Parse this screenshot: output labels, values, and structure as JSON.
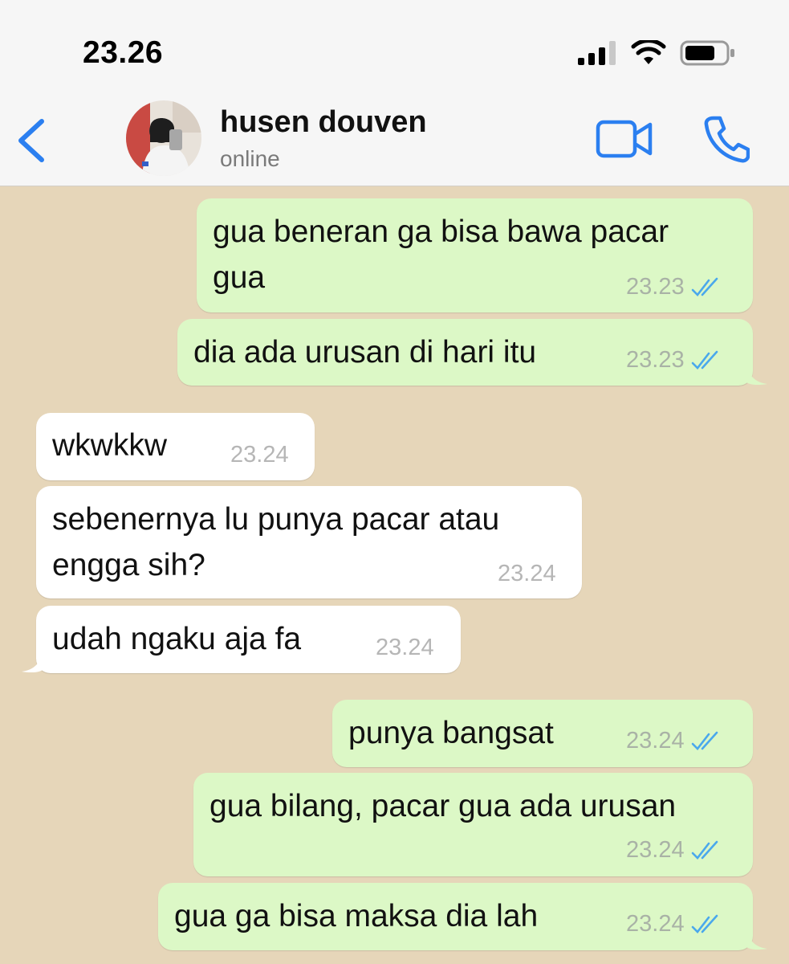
{
  "status_bar": {
    "time": "23.26",
    "signal_icon": "cellular-signal-icon",
    "wifi_icon": "wifi-icon",
    "battery_icon": "battery-icon"
  },
  "header": {
    "back_icon": "chevron-left-icon",
    "contact_name": "husen douven",
    "contact_status": "online",
    "video_icon": "video-camera-icon",
    "call_icon": "phone-icon"
  },
  "colors": {
    "accent": "#2b7ff0",
    "outgoing_bubble": "#dcf8c6",
    "incoming_bubble": "#ffffff",
    "chat_background": "#e6d6b9",
    "read_ticks": "#4aa8ec"
  },
  "messages": [
    {
      "direction": "out",
      "lines": [
        "gua beneran ga bisa bawa pacar",
        "gua"
      ],
      "time": "23.23",
      "read": true
    },
    {
      "direction": "out",
      "lines": [
        "dia ada urusan di hari itu"
      ],
      "time": "23.23",
      "read": true
    },
    {
      "direction": "in",
      "lines": [
        "wkwkkw"
      ],
      "time": "23.24"
    },
    {
      "direction": "in",
      "lines": [
        "sebenernya lu punya pacar atau",
        "engga sih?"
      ],
      "time": "23.24"
    },
    {
      "direction": "in",
      "lines": [
        "udah ngaku aja fa"
      ],
      "time": "23.24"
    },
    {
      "direction": "out",
      "lines": [
        "punya bangsat"
      ],
      "time": "23.24",
      "read": true
    },
    {
      "direction": "out",
      "lines": [
        "gua bilang, pacar gua ada urusan"
      ],
      "time": "23.24",
      "read": true
    },
    {
      "direction": "out",
      "lines": [
        "gua ga bisa maksa dia lah"
      ],
      "time": "23.24",
      "read": true
    }
  ]
}
